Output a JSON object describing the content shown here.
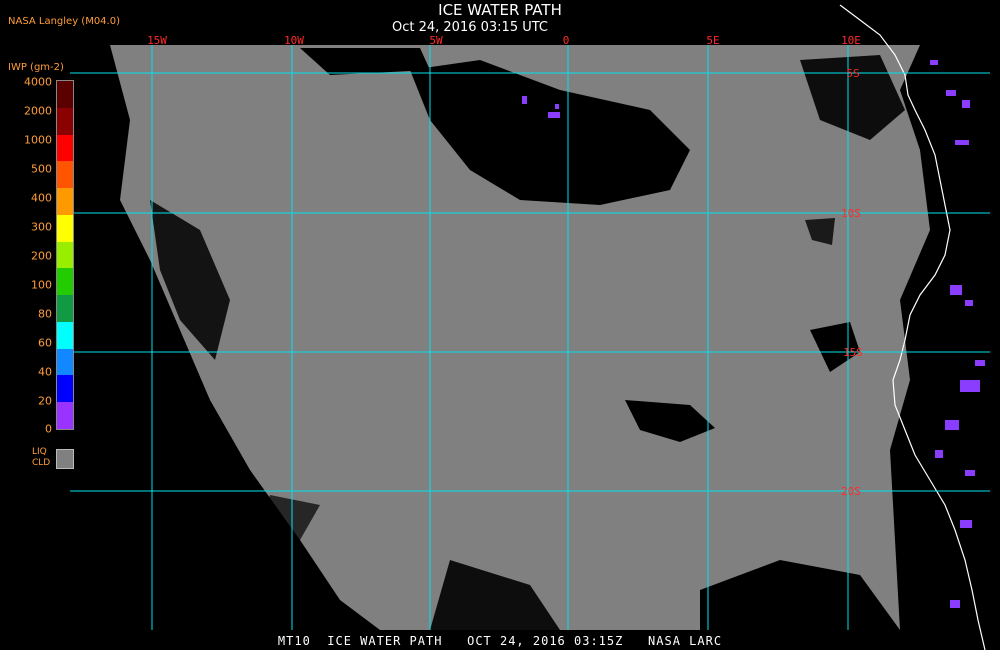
{
  "header": {
    "title": "ICE WATER PATH",
    "subtitle": "Oct 24, 2016 03:15 UTC",
    "source": "NASA Langley (M04.0)"
  },
  "legend": {
    "title": "IWP (gm-2)",
    "labels": [
      "4000",
      "2000",
      "1000",
      "500",
      "400",
      "300",
      "200",
      "100",
      "80",
      "60",
      "40",
      "20",
      "0"
    ],
    "colors": [
      "#5a0000",
      "#8b0000",
      "#ff0000",
      "#ff5500",
      "#ff9900",
      "#ffff00",
      "#99ee00",
      "#22cc00",
      "#119944",
      "#00ffff",
      "#1188ff",
      "#0000ff",
      "#9933ff"
    ],
    "liq_label_1": "LIQ",
    "liq_label_2": "CLD",
    "liq_color": "#808080"
  },
  "map": {
    "lon_labels": [
      "15W",
      "10W",
      "5W",
      "0",
      "5E",
      "10E"
    ],
    "lat_labels": [
      "5S",
      "10S",
      "15S",
      "20S"
    ],
    "grid_color": "#00e5ee",
    "label_color": "#ff2a2a",
    "cloud_color": "#808080",
    "clear_color": "#000000",
    "ice_color": "#8a3cff",
    "coast_color": "#ffffff"
  },
  "footer": {
    "text": "MT10  ICE WATER PATH   OCT 24, 2016 03:15Z   NASA LARC"
  }
}
